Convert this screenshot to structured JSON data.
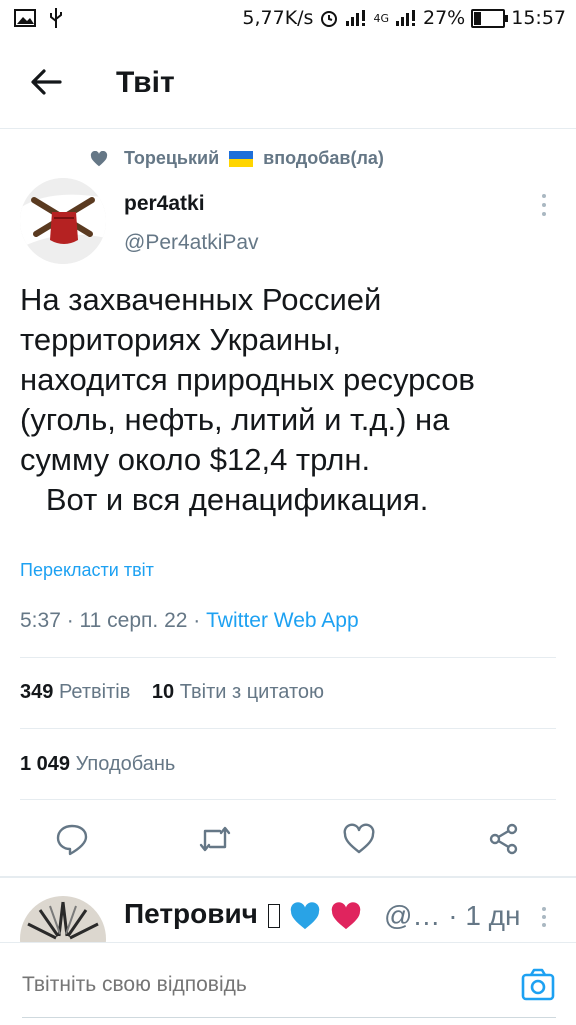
{
  "status_bar": {
    "net_speed": "5,77K/s",
    "network_label": "4G",
    "battery_percent_label": "27%",
    "battery_level": 0.27,
    "time": "15:57"
  },
  "header": {
    "title": "Твіт"
  },
  "social_context": {
    "user": "Торецький",
    "action": "вподобав(ла)"
  },
  "tweet": {
    "author_name": "per4atki",
    "author_handle": "@Per4atkiPav",
    "text": "На захваченных Россией\nтерриториях Украины,\nнаходится природных ресурсов\n(уголь, нефть, литий и т.д.) на\nсумму около $12,4 трлн.\n   Вот и вся денацификация.",
    "translate_label": "Перекласти твіт",
    "time": "5:37",
    "date": "11 серп. 22",
    "source": "Twitter Web App",
    "retweets_count": "349",
    "retweets_label": "Ретвітів",
    "quotes_count": "10",
    "quotes_label": "Твіти з цитатою",
    "likes_count": "1 049",
    "likes_label": "Уподобань"
  },
  "reply_preview": {
    "name": "Петрович",
    "handle_truncated": "@…",
    "time": "1 дн"
  },
  "compose": {
    "placeholder": "Твітніть свою відповідь"
  },
  "colors": {
    "accent": "#1da1f2",
    "secondary_text": "#657786",
    "primary_text": "#14171a",
    "heart_blue": "#29a3e6",
    "heart_pink": "#e0245e"
  },
  "icons": [
    "image-icon",
    "usb-icon",
    "alarm-icon",
    "signal-icon",
    "battery-icon",
    "back-arrow-icon",
    "heart-icon",
    "flag-ua-icon",
    "more-icon",
    "reply-icon",
    "retweet-icon",
    "like-icon",
    "share-icon",
    "camera-icon"
  ]
}
